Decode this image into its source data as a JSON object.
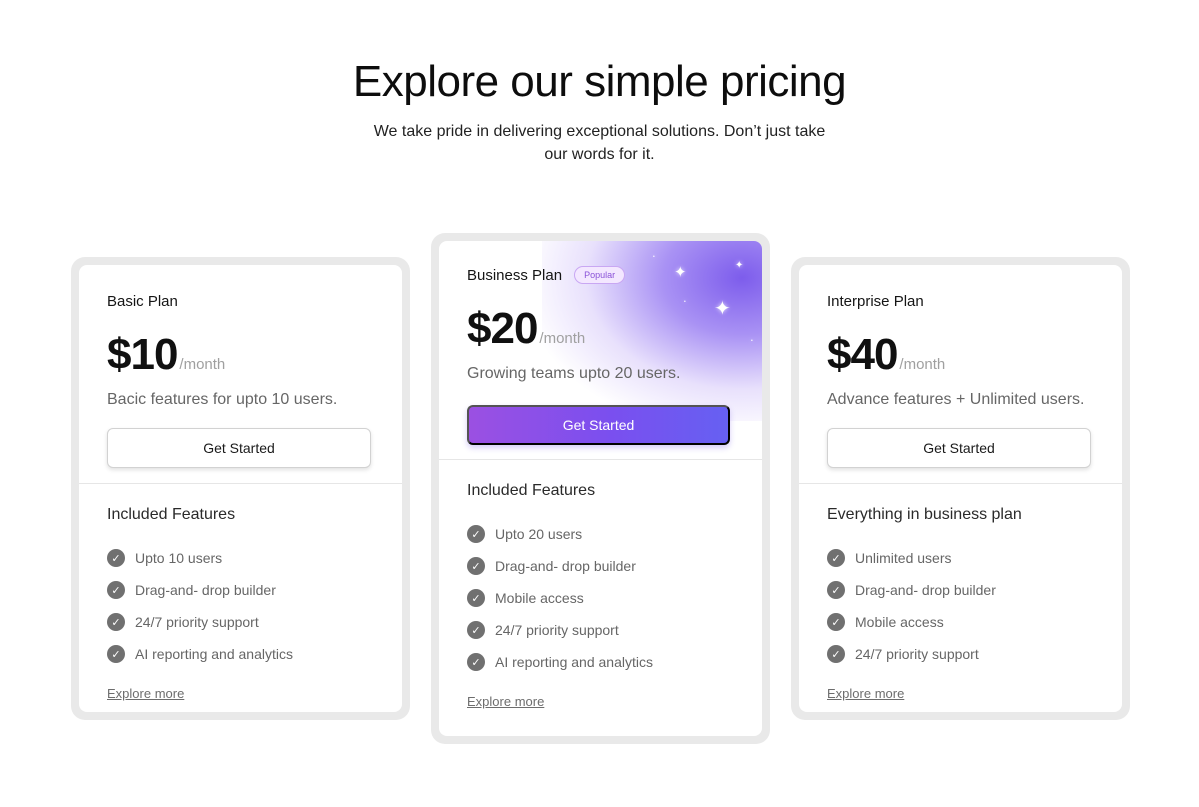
{
  "hero": {
    "title": "Explore our simple pricing",
    "subtitle": "We take pride in delivering exceptional solutions. Don’t just take our words for it."
  },
  "plans": [
    {
      "name": "Basic Plan",
      "price": "$10",
      "period": "/month",
      "description": "Bacic features for upto 10 users.",
      "cta": "Get Started",
      "features_title": "Included Features",
      "features": [
        "Upto 10 users",
        "Drag-and- drop builder",
        "24/7 priority support",
        "AI reporting and analytics"
      ],
      "link": "Explore more"
    },
    {
      "name": "Business Plan",
      "badge": "Popular",
      "price": "$20",
      "period": "/month",
      "description": "Growing teams upto 20 users.",
      "cta": "Get Started",
      "features_title": "Included Features",
      "features": [
        "Upto 20 users",
        "Drag-and- drop builder",
        "Mobile access",
        "24/7 priority support",
        "AI reporting and analytics"
      ],
      "link": "Explore more"
    },
    {
      "name": "Interprise Plan",
      "price": "$40",
      "period": "/month",
      "description": "Advance features + Unlimited users.",
      "cta": "Get Started",
      "features_title": "Everything in business plan",
      "features": [
        "Unlimited users",
        "Drag-and- drop builder",
        "Mobile access",
        "24/7 priority support"
      ],
      "link": "Explore more"
    }
  ],
  "colors": {
    "accent_start": "#9b50e2",
    "accent_end": "#6660f2",
    "badge_text": "#8a52d8",
    "check_icon": "#707070"
  },
  "icons": {
    "feature": "check-badge-icon",
    "sparkle": "sparkle-icon"
  }
}
